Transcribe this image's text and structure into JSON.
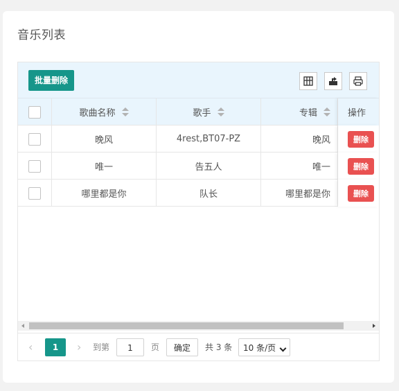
{
  "page": {
    "title": "音乐列表"
  },
  "toolbar": {
    "batch_delete_label": "批量删除",
    "icons": [
      "columns-icon",
      "export-icon",
      "print-icon"
    ]
  },
  "table": {
    "columns": {
      "name": "歌曲名称",
      "singer": "歌手",
      "album": "专辑",
      "op": "操作"
    },
    "rows": [
      {
        "name": "晚风",
        "singer": "4rest,BT07-PZ",
        "album": "晚风",
        "action": "删除"
      },
      {
        "name": "唯一",
        "singer": "告五人",
        "album": "唯一",
        "action": "删除"
      },
      {
        "name": "哪里都是你",
        "singer": "队长",
        "album": "哪里都是你",
        "action": "删除"
      }
    ]
  },
  "pagination": {
    "prev": "‹",
    "current": "1",
    "next": "›",
    "goto_label": "到第",
    "goto_value": "1",
    "page_unit": "页",
    "confirm": "确定",
    "total": "共 3 条",
    "page_size": "10 条/页"
  },
  "colors": {
    "primary": "#16968a",
    "danger": "#e95151",
    "header_bg": "#e9f5fd"
  }
}
